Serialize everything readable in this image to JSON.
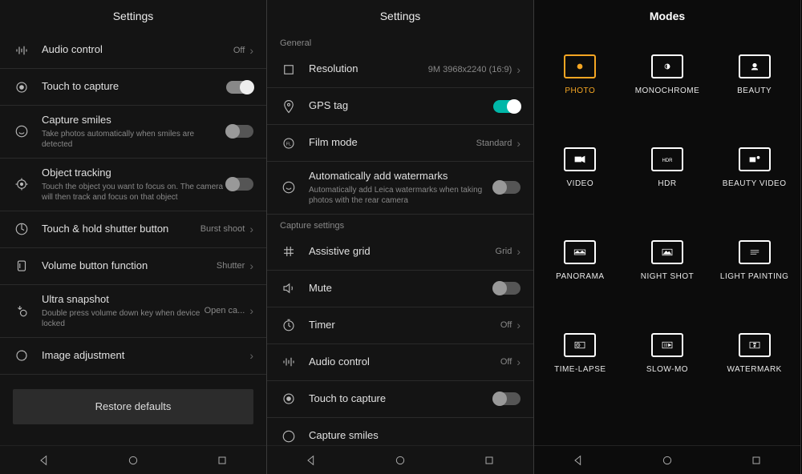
{
  "panel1": {
    "title": "Settings",
    "items": [
      {
        "label": "Audio control",
        "value": "Off",
        "type": "chevron"
      },
      {
        "label": "Touch to capture",
        "type": "toggle",
        "state": "on-white"
      },
      {
        "label": "Capture smiles",
        "sub": "Take photos automatically when smiles are detected",
        "type": "toggle",
        "state": "off"
      },
      {
        "label": "Object tracking",
        "sub": "Touch the object you want to focus on. The camera will then track and focus on that object",
        "type": "toggle",
        "state": "off"
      },
      {
        "label": "Touch & hold shutter button",
        "value": "Burst shoot",
        "type": "chevron"
      },
      {
        "label": "Volume button function",
        "value": "Shutter",
        "type": "chevron"
      },
      {
        "label": "Ultra snapshot",
        "sub": "Double press volume down key when device locked",
        "value": "Open ca...",
        "type": "chevron"
      },
      {
        "label": "Image adjustment",
        "type": "chevron"
      }
    ],
    "restore": "Restore defaults"
  },
  "panel2": {
    "title": "Settings",
    "section1": "General",
    "items1": [
      {
        "label": "Resolution",
        "value": "9M 3968x2240 (16:9)",
        "type": "chevron"
      },
      {
        "label": "GPS tag",
        "type": "toggle",
        "state": "on"
      },
      {
        "label": "Film mode",
        "value": "Standard",
        "type": "chevron"
      },
      {
        "label": "Automatically add watermarks",
        "sub": "Automatically add Leica watermarks when taking photos with the rear camera",
        "type": "toggle",
        "state": "off"
      }
    ],
    "section2": "Capture settings",
    "items2": [
      {
        "label": "Assistive grid",
        "value": "Grid",
        "type": "chevron"
      },
      {
        "label": "Mute",
        "type": "toggle",
        "state": "off"
      },
      {
        "label": "Timer",
        "value": "Off",
        "type": "chevron"
      },
      {
        "label": "Audio control",
        "value": "Off",
        "type": "chevron"
      },
      {
        "label": "Touch to capture",
        "type": "toggle",
        "state": "off"
      },
      {
        "label": "Capture smiles",
        "type": "none"
      }
    ]
  },
  "panel3": {
    "title": "Modes",
    "modes": [
      {
        "label": "PHOTO",
        "active": true
      },
      {
        "label": "MONOCHROME"
      },
      {
        "label": "BEAUTY"
      },
      {
        "label": "VIDEO"
      },
      {
        "label": "HDR"
      },
      {
        "label": "BEAUTY VIDEO"
      },
      {
        "label": "PANORAMA"
      },
      {
        "label": "NIGHT SHOT"
      },
      {
        "label": "LIGHT PAINTING"
      },
      {
        "label": "TIME-LAPSE"
      },
      {
        "label": "SLOW-MO"
      },
      {
        "label": "WATERMARK"
      }
    ]
  }
}
